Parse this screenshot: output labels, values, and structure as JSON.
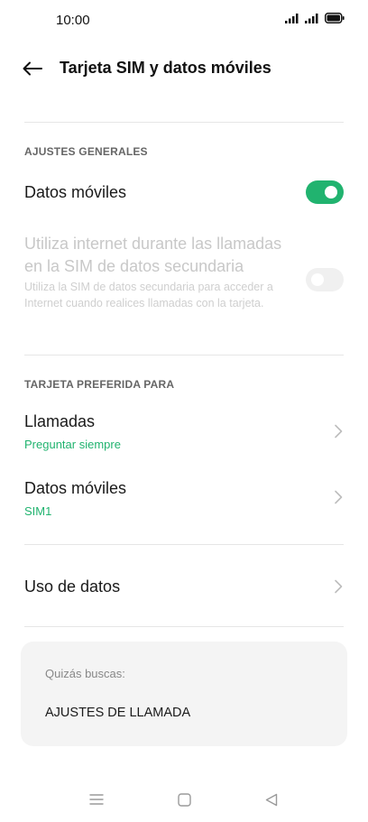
{
  "status_bar": {
    "time": "10:00",
    "icons": [
      "wifi-signal-icon",
      "cell-signal-icon",
      "battery-icon"
    ]
  },
  "app_bar": {
    "back_icon": "arrow-left-icon",
    "title": "Tarjeta SIM y datos móviles"
  },
  "general": {
    "header": "AJUSTES GENERALES",
    "mobile_data": {
      "label": "Datos móviles",
      "enabled": true
    },
    "secondary_sim": {
      "title": "Utiliza internet durante las llamadas en la SIM de datos secundaria",
      "description": "Utiliza la SIM de datos secundaria para acceder a Internet cuando realices llamadas con la tarjeta.",
      "enabled": false,
      "disabled": true
    }
  },
  "preferred": {
    "header": "TARJETA PREFERIDA PARA",
    "calls": {
      "label": "Llamadas",
      "value": "Preguntar siempre"
    },
    "data": {
      "label": "Datos móviles",
      "value": "SIM1"
    }
  },
  "data_usage": {
    "label": "Uso de datos"
  },
  "suggestions": {
    "label": "Quizás buscas:",
    "items": [
      "AJUSTES DE LLAMADA"
    ]
  },
  "colors": {
    "accent": "#21b36f",
    "disabled_text": "#c8c8c8"
  }
}
